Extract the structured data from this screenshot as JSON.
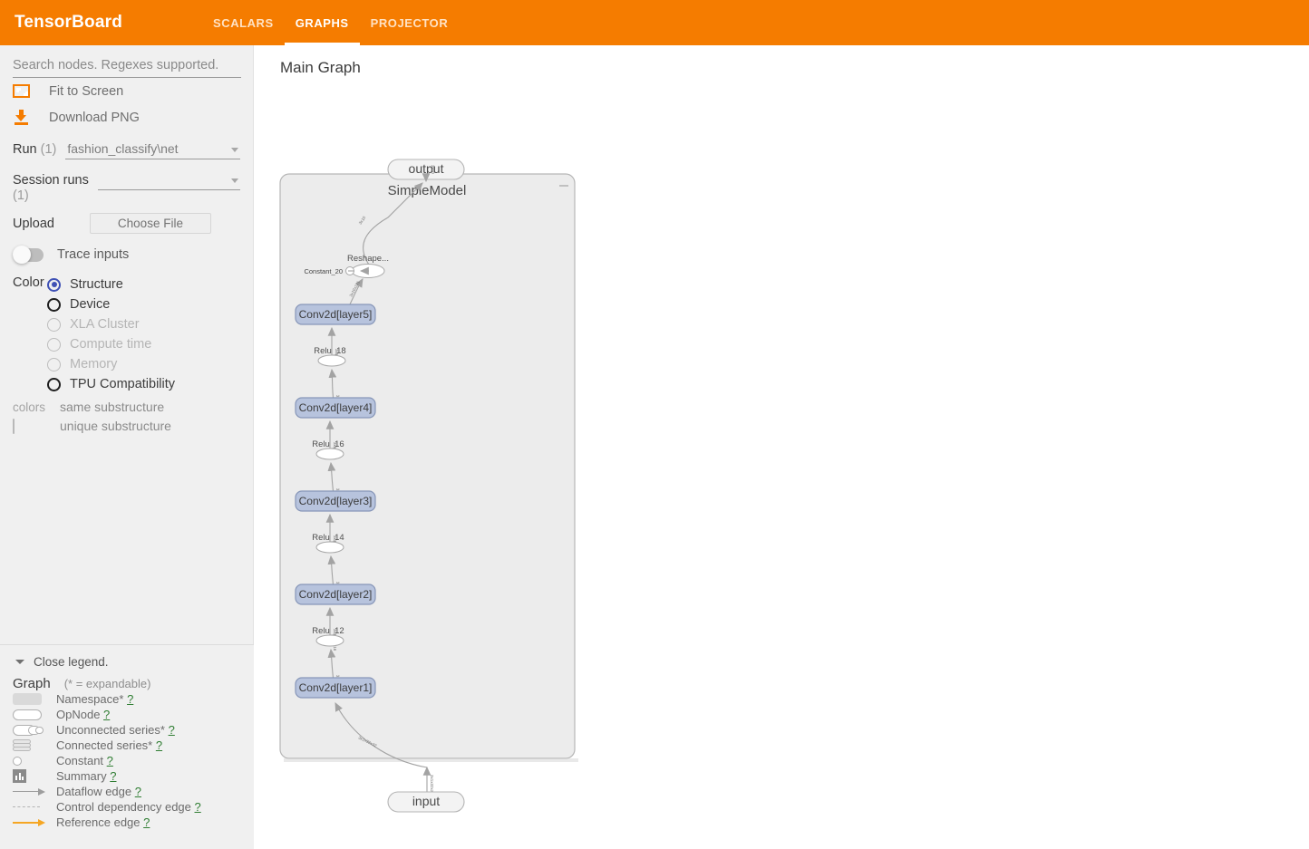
{
  "header": {
    "brand": "TensorBoard",
    "tabs": [
      {
        "label": "SCALARS",
        "active": false
      },
      {
        "label": "GRAPHS",
        "active": true
      },
      {
        "label": "PROJECTOR",
        "active": false
      }
    ]
  },
  "sidebar": {
    "search": {
      "placeholder": "Search nodes. Regexes supported.",
      "value": ""
    },
    "actions": [
      {
        "label": "Fit to Screen",
        "icon": "fit-to-screen-icon"
      },
      {
        "label": "Download PNG",
        "icon": "download-icon"
      }
    ],
    "run": {
      "label": "Run",
      "count": "(1)",
      "value": "fashion_classify\\net"
    },
    "session_runs": {
      "label": "Session runs",
      "count": "(1)",
      "value": ""
    },
    "upload": {
      "label": "Upload",
      "button": "Choose File"
    },
    "trace_inputs": {
      "label": "Trace inputs",
      "enabled": false
    },
    "color": {
      "label": "Color",
      "options": [
        {
          "label": "Structure",
          "selected": true,
          "disabled": false
        },
        {
          "label": "Device",
          "selected": false,
          "disabled": false
        },
        {
          "label": "XLA Cluster",
          "selected": false,
          "disabled": true
        },
        {
          "label": "Compute time",
          "selected": false,
          "disabled": true
        },
        {
          "label": "Memory",
          "selected": false,
          "disabled": true
        },
        {
          "label": "TPU Compatibility",
          "selected": false,
          "disabled": false
        }
      ],
      "legend_key": "colors",
      "legend_same": "same substructure",
      "legend_unique": "unique substructure"
    }
  },
  "legend": {
    "close_label": "Close legend.",
    "title": "Graph",
    "subtitle": "(* = expandable)",
    "items": [
      {
        "label": "Namespace*",
        "help": "?",
        "sym": "namespace"
      },
      {
        "label": "OpNode",
        "help": "?",
        "sym": "opnode"
      },
      {
        "label": "Unconnected series*",
        "help": "?",
        "sym": "unconnected"
      },
      {
        "label": "Connected series*",
        "help": "?",
        "sym": "connected"
      },
      {
        "label": "Constant",
        "help": "?",
        "sym": "constant"
      },
      {
        "label": "Summary",
        "help": "?",
        "sym": "summary"
      },
      {
        "label": "Dataflow edge",
        "help": "?",
        "sym": "dataflow"
      },
      {
        "label": "Control dependency edge",
        "help": "?",
        "sym": "control"
      },
      {
        "label": "Reference edge",
        "help": "?",
        "sym": "reference"
      }
    ]
  },
  "graph": {
    "title": "Main Graph",
    "nodes": {
      "output": "output",
      "namespace": "SimpleModel",
      "reshape": "Reshape...",
      "constant": "Constant_20",
      "conv5": "Conv2d[layer5]",
      "relu18": "Relu_18",
      "conv4": "Conv2d[layer4]",
      "relu16": "Relu_16",
      "conv3": "Conv2d[layer3]",
      "relu14": "Relu_14",
      "conv2": "Conv2d[layer2]",
      "relu12": "Relu_12",
      "conv1": "Conv2d[layer1]",
      "input": "input"
    },
    "edge_labels": {
      "output_edge": "3x10",
      "reshape_out": "3x10",
      "conv5_out": "3x10x1x1",
      "relu18_out": "3x64x1x1",
      "conv4_out": "3x64x2x2",
      "relu16_out": "3x64x4x4",
      "conv3_out": "3x64x4x4",
      "relu14_out": "3x32x8x8",
      "conv2_out": "3x32x8x8",
      "relu12_out": "3x32x16x16",
      "conv1_out": "3x32x32x32",
      "input_edge": "3x1x32x32"
    },
    "colors": {
      "namespace_fill": "#ececec",
      "namespace_stroke": "#b6b6b6",
      "op_fill": "#ffffff",
      "op_stroke": "#a8a8a8",
      "conv_fill": "#b7c3dd",
      "conv_stroke": "#8796b8",
      "edge": "#a3a3a3",
      "text": "#4a4a4a"
    }
  }
}
